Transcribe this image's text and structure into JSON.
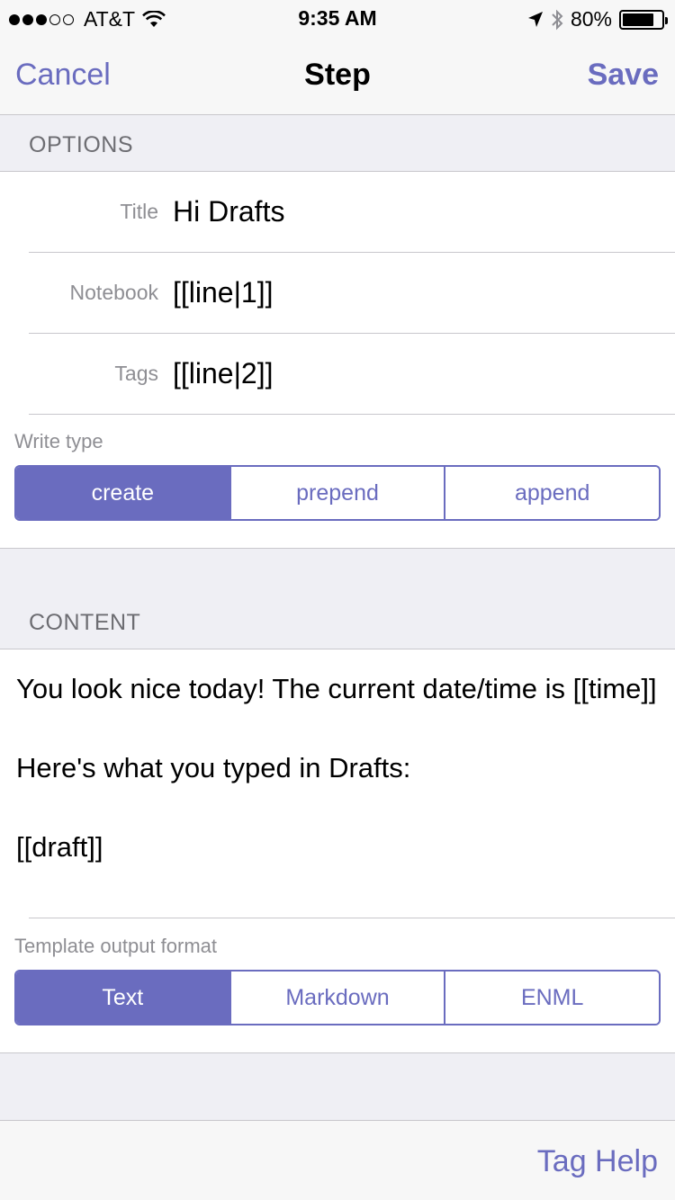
{
  "status_bar": {
    "signal_dots": [
      "full",
      "full",
      "full",
      "empty",
      "empty"
    ],
    "carrier": "AT&T",
    "time": "9:35 AM",
    "battery_percent": "80%",
    "battery_level": 0.8,
    "icons": [
      "wifi-icon",
      "location-arrow-icon",
      "bluetooth-icon",
      "battery-icon"
    ]
  },
  "nav": {
    "cancel_label": "Cancel",
    "title": "Step",
    "save_label": "Save"
  },
  "options": {
    "header": "OPTIONS",
    "fields": [
      {
        "label": "Title",
        "value": "Hi Drafts"
      },
      {
        "label": "Notebook",
        "value": "[[line|1]]"
      },
      {
        "label": "Tags",
        "value": "[[line|2]]"
      }
    ],
    "write_type": {
      "label": "Write type",
      "segments": [
        "create",
        "prepend",
        "append"
      ],
      "selected": "create"
    }
  },
  "content": {
    "header": "CONTENT",
    "paragraphs": [
      "You look nice today! The current date/time is [[time]]",
      "Here's what you typed in Drafts:",
      "[[draft]]"
    ],
    "output_format": {
      "label": "Template output format",
      "segments": [
        "Text",
        "Markdown",
        "ENML"
      ],
      "selected": "Text"
    }
  },
  "bottom_bar": {
    "tag_help_label": "Tag Help"
  },
  "colors": {
    "accent": "#6a6cbf",
    "background": "#efeff4",
    "separator": "#c8c7cc",
    "secondary_text": "#8e8e93"
  }
}
